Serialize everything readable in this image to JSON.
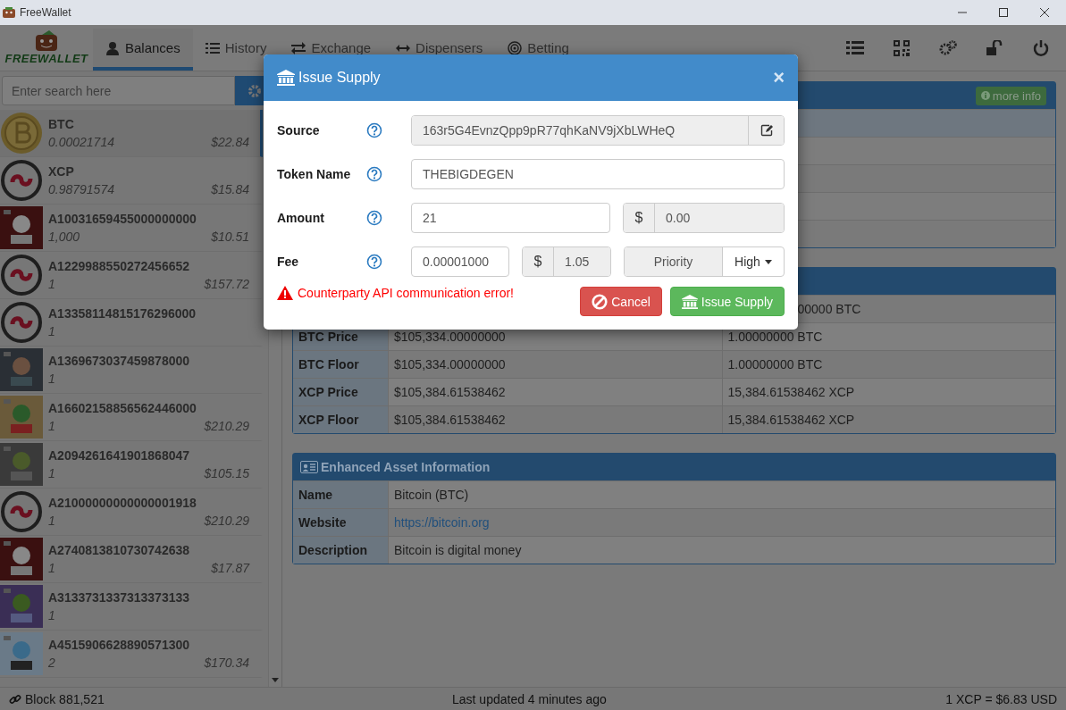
{
  "window": {
    "title": "FreeWallet"
  },
  "nav": {
    "logo": "FREEWALLET",
    "tabs": [
      {
        "label": "Balances",
        "kind": "user",
        "selected": true
      },
      {
        "label": "History",
        "kind": "list",
        "selected": false
      },
      {
        "label": "Exchange",
        "kind": "swap",
        "selected": false
      },
      {
        "label": "Dispensers",
        "kind": "arrows",
        "selected": false
      },
      {
        "label": "Betting",
        "kind": "target",
        "selected": false
      }
    ]
  },
  "search": {
    "placeholder": "Enter search here"
  },
  "balances": [
    {
      "name": "BTC",
      "amount": "0.00021714",
      "value": "$22.84",
      "kind": "coin",
      "selected": true
    },
    {
      "name": "XCP",
      "amount": "0.98791574",
      "value": "$15.84",
      "kind": "ring",
      "selected": false
    },
    {
      "name": "A10031659455000000000",
      "amount": "1,000",
      "value": "$10.51",
      "kind": "picture",
      "selected": false
    },
    {
      "name": "A1229988550272456652",
      "amount": "1",
      "value": "$157.72",
      "kind": "ring",
      "selected": false
    },
    {
      "name": "A13358114815176296000",
      "amount": "1",
      "kind": "ring",
      "selected": false
    },
    {
      "name": "A1369673037459878000",
      "amount": "1",
      "kind": "picture",
      "selected": false
    },
    {
      "name": "A16602158856562446000",
      "amount": "1",
      "value": "$210.29",
      "kind": "picture",
      "selected": false
    },
    {
      "name": "A2094261641901868047",
      "amount": "1",
      "value": "$105.15",
      "kind": "picture",
      "selected": false
    },
    {
      "name": "A21000000000000001918",
      "amount": "1",
      "value": "$210.29",
      "kind": "ring",
      "selected": false
    },
    {
      "name": "A2740813810730742638",
      "amount": "1",
      "value": "$17.87",
      "kind": "picture",
      "selected": false
    },
    {
      "name": "A3133731337313373133",
      "amount": "1",
      "kind": "picture",
      "selected": false
    },
    {
      "name": "A4515906628890571300",
      "amount": "2",
      "value": "$170.34",
      "kind": "picture",
      "selected": false
    }
  ],
  "info_panel": {
    "button": "more info"
  },
  "price_table": {
    "rows": [
      {
        "kind": "cut",
        "native": "00000 BTC"
      },
      {
        "kind": "full",
        "label": "BTC Price",
        "usd": "$105,334.00000000",
        "native": "1.00000000 BTC"
      },
      {
        "kind": "full",
        "label": "BTC Floor",
        "usd": "$105,334.00000000",
        "native": "1.00000000 BTC"
      },
      {
        "kind": "full",
        "label": "XCP Price",
        "usd": "$105,384.61538462",
        "native": "15,384.61538462 XCP"
      },
      {
        "kind": "full",
        "label": "XCP Floor",
        "usd": "$105,384.61538462",
        "native": "15,384.61538462 XCP"
      }
    ]
  },
  "asset_info": {
    "title": "Enhanced Asset Information",
    "rows": [
      {
        "label": "Name",
        "value": "Bitcoin (BTC)",
        "kind": "text"
      },
      {
        "label": "Website",
        "value": "https://bitcoin.org",
        "kind": "link"
      },
      {
        "label": "Description",
        "value": "Bitcoin is digital money",
        "kind": "text"
      }
    ]
  },
  "modal": {
    "title": "Issue Supply",
    "close": "×",
    "fields": [
      {
        "label": "Source",
        "kind": "address",
        "value": "163r5G4EvnzQpp9pR77qhKaNV9jXbLWHeQ"
      },
      {
        "label": "Token Name",
        "kind": "text",
        "value": "THEBIGDEGEN"
      },
      {
        "label": "Amount",
        "kind": "amount",
        "value": "21",
        "currency": "$",
        "usd": "0.00"
      },
      {
        "label": "Fee",
        "kind": "fee",
        "value": "0.00001000",
        "currency": "$",
        "usd": "1.05",
        "priority_label": "Priority",
        "priority": "High"
      }
    ],
    "error": "Counterparty API communication error!",
    "buttons": [
      {
        "label": "Cancel",
        "kind": "cancel"
      },
      {
        "label": "Issue Supply",
        "kind": "submit"
      }
    ]
  },
  "status_bar": {
    "block": "Block 881,521",
    "updated": "Last updated 4 minutes ago",
    "rate": "1 XCP = $6.83 USD"
  }
}
